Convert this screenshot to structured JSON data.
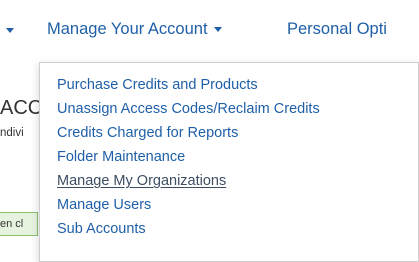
{
  "navbar": {
    "items": [
      {
        "label": "Manage Your Account"
      },
      {
        "label": "Personal Opti"
      }
    ]
  },
  "background": {
    "heading_fragment": "ACC",
    "sub_fragment": "ndivi",
    "alert_fragment": "en cl"
  },
  "dropdown": {
    "items": [
      {
        "label": "Purchase Credits and Products"
      },
      {
        "label": "Unassign Access Codes/Reclaim Credits"
      },
      {
        "label": "Credits Charged for Reports"
      },
      {
        "label": "Folder Maintenance"
      },
      {
        "label": "Manage My Organizations"
      },
      {
        "label": "Manage Users"
      },
      {
        "label": "Sub Accounts"
      }
    ]
  },
  "colors": {
    "link": "#1f5fa8",
    "active_link": "#3d4e63",
    "alert_bg": "#e6f3df",
    "alert_border": "#8bbf6f"
  },
  "icons": [
    "chevron-down-icon"
  ]
}
